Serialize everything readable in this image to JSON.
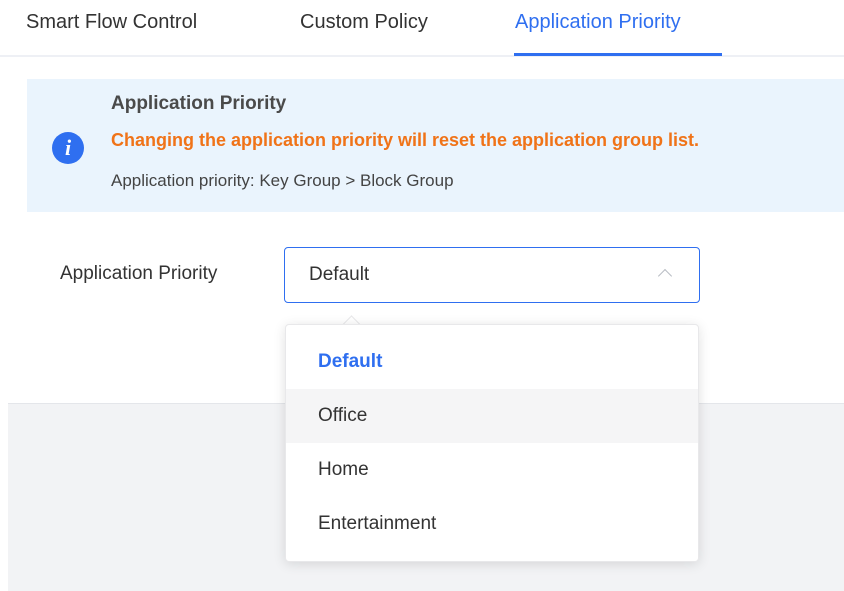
{
  "tabs": [
    {
      "label": "Smart Flow Control"
    },
    {
      "label": "Custom Policy"
    },
    {
      "label": "Application Priority",
      "active": true
    }
  ],
  "notice": {
    "icon": "info-icon",
    "title": "Application Priority",
    "warning": "Changing the application priority will reset the application group list.",
    "description": "Application priority: Key Group > Block Group"
  },
  "form": {
    "label": "Application Priority",
    "selected_value": "Default",
    "chevron_icon": "chevron-up-icon"
  },
  "dropdown": {
    "options": [
      {
        "label": "Default",
        "selected": true
      },
      {
        "label": "Office",
        "hovered": true
      },
      {
        "label": "Home"
      },
      {
        "label": "Entertainment"
      }
    ]
  },
  "colors": {
    "accent": "#2f6ff0",
    "warning": "#f07318",
    "notice_bg": "#eaf4fd"
  }
}
